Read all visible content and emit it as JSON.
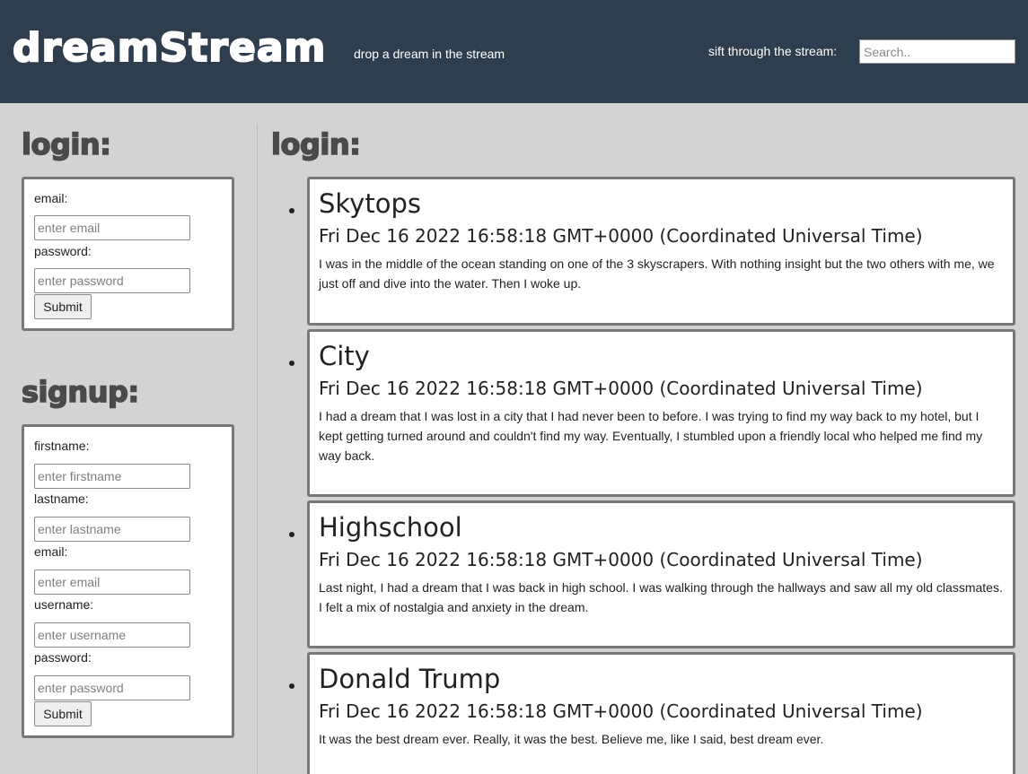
{
  "header": {
    "logo": "dreamStream",
    "tagline": "drop a dream in the stream",
    "search_label": "sift through the stream:",
    "search_placeholder": "Search.."
  },
  "sidebar": {
    "login": {
      "heading": "login:",
      "email_label": "email:",
      "email_placeholder": "enter email",
      "password_label": "password:",
      "password_placeholder": "enter password",
      "submit_label": "Submit"
    },
    "signup": {
      "heading": "signup:",
      "firstname_label": "firstname:",
      "firstname_placeholder": "enter firstname",
      "lastname_label": "lastname:",
      "lastname_placeholder": "enter lastname",
      "email_label": "email:",
      "email_placeholder": "enter email",
      "username_label": "username:",
      "username_placeholder": "enter username",
      "password_label": "password:",
      "password_placeholder": "enter password",
      "submit_label": "Submit"
    }
  },
  "feed": {
    "heading": "login:",
    "dreams": [
      {
        "title": "Skytops",
        "date": "Fri Dec 16 2022 16:58:18 GMT+0000 (Coordinated Universal Time)",
        "body": "I was in the middle of the ocean standing on one of the 3 skyscrapers. With nothing insight but the two others with me, we just off and dive into the water. Then I woke up."
      },
      {
        "title": "City",
        "date": "Fri Dec 16 2022 16:58:18 GMT+0000 (Coordinated Universal Time)",
        "body": "I had a dream that I was lost in a city that I had never been to before. I was trying to find my way back to my hotel, but I kept getting turned around and couldn't find my way. Eventually, I stumbled upon a friendly local who helped me find my way back."
      },
      {
        "title": "Highschool",
        "date": "Fri Dec 16 2022 16:58:18 GMT+0000 (Coordinated Universal Time)",
        "body": "Last night, I had a dream that I was back in high school. I was walking through the hallways and saw all my old classmates. I felt a mix of nostalgia and anxiety in the dream."
      },
      {
        "title": "Donald Trump",
        "date": "Fri Dec 16 2022 16:58:18 GMT+0000 (Coordinated Universal Time)",
        "body": "It was the best dream ever. Really, it was the best. Believe me, like I said, best dream ever."
      }
    ]
  },
  "colors": {
    "header_bg": "#2e3e4f",
    "page_bg": "#d3d3d3",
    "card_border": "#777777"
  }
}
